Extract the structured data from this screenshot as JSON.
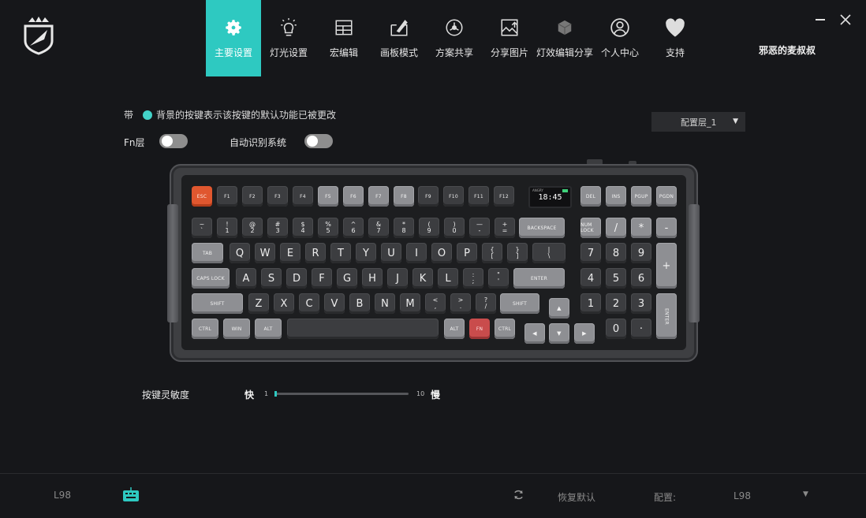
{
  "nav": {
    "items": [
      {
        "label": "主要设置",
        "icon": "gear-icon"
      },
      {
        "label": "灯光设置",
        "icon": "lightbulb-icon"
      },
      {
        "label": "宏编辑",
        "icon": "macro-grid-icon"
      },
      {
        "label": "画板模式",
        "icon": "paint-board-icon"
      },
      {
        "label": "方案共享",
        "icon": "share-scheme-icon"
      },
      {
        "label": "分享图片",
        "icon": "share-image-icon"
      },
      {
        "label": "灯效编辑分享",
        "icon": "cube-icon"
      },
      {
        "label": "个人中心",
        "icon": "user-icon"
      },
      {
        "label": "支持",
        "icon": "heart-icon"
      }
    ],
    "active_index": 0
  },
  "user": {
    "name": "邪恶的麦叔叔"
  },
  "settings": {
    "legend_prefix": "带",
    "legend_text": "背景的按键表示该按键的默认功能已被更改",
    "fn_layer_label": "Fn层",
    "fn_layer_on": false,
    "auto_detect_label": "自动识别系统",
    "auto_detect_on": false,
    "layer_select_value": "配置层_1"
  },
  "keyboard": {
    "screen_time": "18:45",
    "screen_header": "ANGRY",
    "row_f": [
      "ESC",
      "F1",
      "F2",
      "F3",
      "F4",
      "F5",
      "F6",
      "F7",
      "F8",
      "F9",
      "F10",
      "F11",
      "F12"
    ],
    "nav_cluster_top": [
      "DEL",
      "INS",
      "PGUP",
      "PGDN"
    ],
    "row_num": [
      [
        "~",
        "`"
      ],
      [
        "!",
        "1"
      ],
      [
        "@",
        "2"
      ],
      [
        "#",
        "3"
      ],
      [
        "$",
        "4"
      ],
      [
        "%",
        "5"
      ],
      [
        "^",
        "6"
      ],
      [
        "&",
        "7"
      ],
      [
        "*",
        "8"
      ],
      [
        "(",
        "9"
      ],
      [
        ")",
        "0"
      ],
      [
        "—",
        "-"
      ],
      [
        "+",
        "="
      ]
    ],
    "backspace": "BACKSPACE",
    "numlock": "NUM LOCK",
    "num_ops": [
      "/",
      "*",
      "-"
    ],
    "tab": "TAB",
    "row_q": [
      "Q",
      "W",
      "E",
      "R",
      "T",
      "Y",
      "U",
      "I",
      "O",
      "P"
    ],
    "row_q_sym": [
      [
        "{",
        "["
      ],
      [
        "}",
        "]"
      ],
      [
        "|",
        "\\"
      ]
    ],
    "num_789": [
      "7",
      "8",
      "9"
    ],
    "num_plus": "+",
    "caps": "CAPS LOCK",
    "row_a": [
      "A",
      "S",
      "D",
      "F",
      "G",
      "H",
      "J",
      "K",
      "L"
    ],
    "row_a_sym": [
      [
        ":",
        ";"
      ],
      [
        "\"",
        "'"
      ]
    ],
    "enter": "ENTER",
    "num_456": [
      "4",
      "5",
      "6"
    ],
    "shift_l": "SHIFT",
    "row_z": [
      "Z",
      "X",
      "C",
      "V",
      "B",
      "N",
      "M"
    ],
    "row_z_sym": [
      [
        "<",
        ","
      ],
      [
        ">",
        "."
      ],
      [
        "?",
        "/"
      ]
    ],
    "shift_r": "SHIFT",
    "num_123": [
      "1",
      "2",
      "3"
    ],
    "num_enter": "ENTER",
    "ctrl_l": "CTRL",
    "win": "WIN",
    "alt_l": "ALT",
    "alt_r": "ALT",
    "fn": "FN",
    "ctrl_r": "CTRL",
    "num_0": "0",
    "num_dot": "·"
  },
  "sensitivity": {
    "label": "按键灵敏度",
    "fast_label": "快",
    "slow_label": "慢",
    "min": "1",
    "max": "10",
    "value_fraction": 0.0
  },
  "footer": {
    "device": "L98",
    "restore_label": "恢复默认",
    "config_label": "配置:",
    "config_value": "L98"
  },
  "colors": {
    "accent": "#2ec9c1",
    "changed_key": "#e0572f"
  }
}
